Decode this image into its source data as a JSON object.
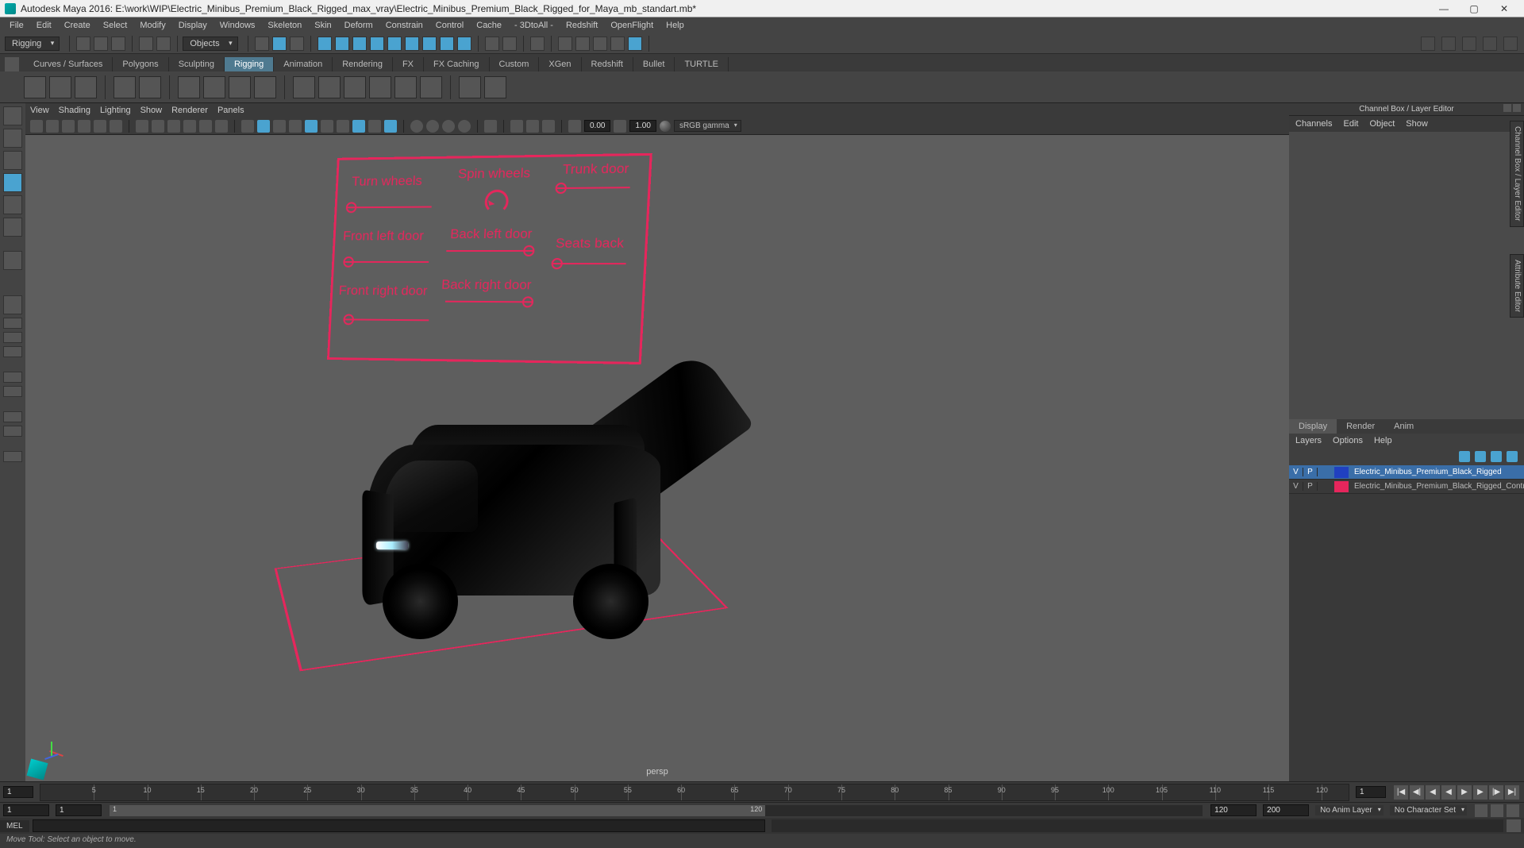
{
  "window": {
    "app": "Autodesk Maya 2016",
    "file": "E:\\work\\WIP\\Electric_Minibus_Premium_Black_Rigged_max_vray\\Electric_Minibus_Premium_Black_Rigged_for_Maya_mb_standart.mb*"
  },
  "menubar": [
    "File",
    "Edit",
    "Create",
    "Select",
    "Modify",
    "Display",
    "Windows",
    "Skeleton",
    "Skin",
    "Deform",
    "Constrain",
    "Control",
    "Cache",
    "- 3DtoAll -",
    "Redshift",
    "OpenFlight",
    "Help"
  ],
  "toolbar": {
    "moduleDropdown": "Rigging",
    "objectsDropdown": "Objects"
  },
  "shelfTabs": [
    "Curves / Surfaces",
    "Polygons",
    "Sculpting",
    "Rigging",
    "Animation",
    "Rendering",
    "FX",
    "FX Caching",
    "Custom",
    "XGen",
    "Redshift",
    "Bullet",
    "TURTLE"
  ],
  "shelfActive": "Rigging",
  "panelMenus": [
    "View",
    "Shading",
    "Lighting",
    "Show",
    "Renderer",
    "Panels"
  ],
  "panelToolbar": {
    "near": "0.00",
    "far": "1.00",
    "colorMode": "sRGB gamma"
  },
  "viewport": {
    "cameraLabel": "persp",
    "rigControls": {
      "turnWheels": "Turn wheels",
      "spinWheels": "Spin wheels",
      "trunkDoor": "Trunk door",
      "frontLeftDoor": "Front left door",
      "backLeftDoor": "Back left door",
      "seatsBack": "Seats back",
      "frontRightDoor": "Front right door",
      "backRightDoor": "Back right door"
    }
  },
  "rightPanel": {
    "title": "Channel Box / Layer Editor",
    "topMenus": [
      "Channels",
      "Edit",
      "Object",
      "Show"
    ],
    "tabs": [
      "Display",
      "Render",
      "Anim"
    ],
    "tabActive": "Display",
    "layersMenus": [
      "Layers",
      "Options",
      "Help"
    ],
    "layers": [
      {
        "v": "V",
        "p": "P",
        "color": "#2040c0",
        "name": "Electric_Minibus_Premium_Black_Rigged",
        "selected": true
      },
      {
        "v": "V",
        "p": "P",
        "color": "#e6265c",
        "name": "Electric_Minibus_Premium_Black_Rigged_Controllers",
        "selected": false
      }
    ]
  },
  "sideTabs": {
    "one": "Channel Box / Layer Editor",
    "two": "Attribute Editor"
  },
  "timeline": {
    "current": "1",
    "ticks": [
      "5",
      "10",
      "15",
      "20",
      "25",
      "30",
      "35",
      "40",
      "45",
      "50",
      "55",
      "60",
      "65",
      "70",
      "75",
      "80",
      "85",
      "90",
      "95",
      "100",
      "105",
      "110",
      "115",
      "120"
    ],
    "endFrame": "1"
  },
  "range": {
    "start": "1",
    "inStart": "1",
    "inEnd": "120",
    "end": "200",
    "animLayer": "No Anim Layer",
    "charSet": "No Character Set"
  },
  "cmd": {
    "lang": "MEL"
  },
  "help": "Move Tool: Select an object to move."
}
